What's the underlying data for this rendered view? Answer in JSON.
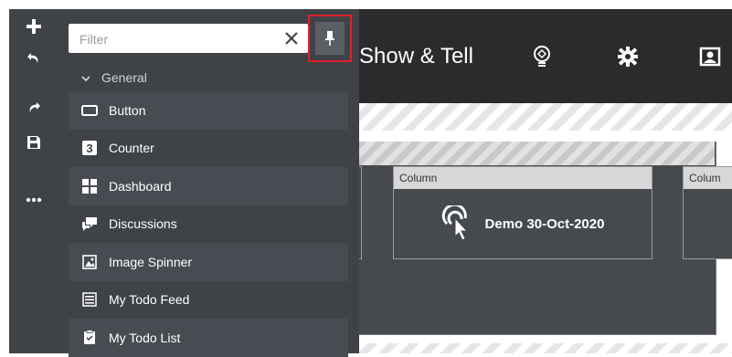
{
  "rail": {
    "buttons": [
      {
        "name": "add",
        "icon": "plus-icon"
      },
      {
        "name": "undo",
        "icon": "undo-icon"
      },
      {
        "name": "redo",
        "icon": "redo-icon"
      },
      {
        "name": "save",
        "icon": "save-icon"
      },
      {
        "name": "more",
        "icon": "more-dots-icon"
      }
    ]
  },
  "header": {
    "title": "Show & Tell",
    "icons": [
      "lightbulb-icon",
      "gear-icon",
      "account-icon"
    ]
  },
  "palette": {
    "search": {
      "placeholder": "Filter",
      "value": ""
    },
    "pin_icon": "pin-icon",
    "group": {
      "label": "General",
      "expanded": true
    },
    "items": [
      {
        "label": "Button",
        "icon": "button-icon"
      },
      {
        "label": "Counter",
        "icon": "counter-icon"
      },
      {
        "label": "Dashboard",
        "icon": "dashboard-icon"
      },
      {
        "label": "Discussions",
        "icon": "discussions-icon"
      },
      {
        "label": "Image Spinner",
        "icon": "image-icon"
      },
      {
        "label": "My Todo Feed",
        "icon": "feed-icon"
      },
      {
        "label": "My Todo List",
        "icon": "clipboard-icon"
      }
    ]
  },
  "canvas": {
    "columns": [
      {
        "label": "Column",
        "content": "Demo 30-Oct-2020",
        "icon": "click-icon"
      },
      {
        "label": "Colum"
      }
    ]
  },
  "colors": {
    "panel": "#3f4247",
    "highlight": "#e0202a",
    "header": "#2b2b2b"
  }
}
